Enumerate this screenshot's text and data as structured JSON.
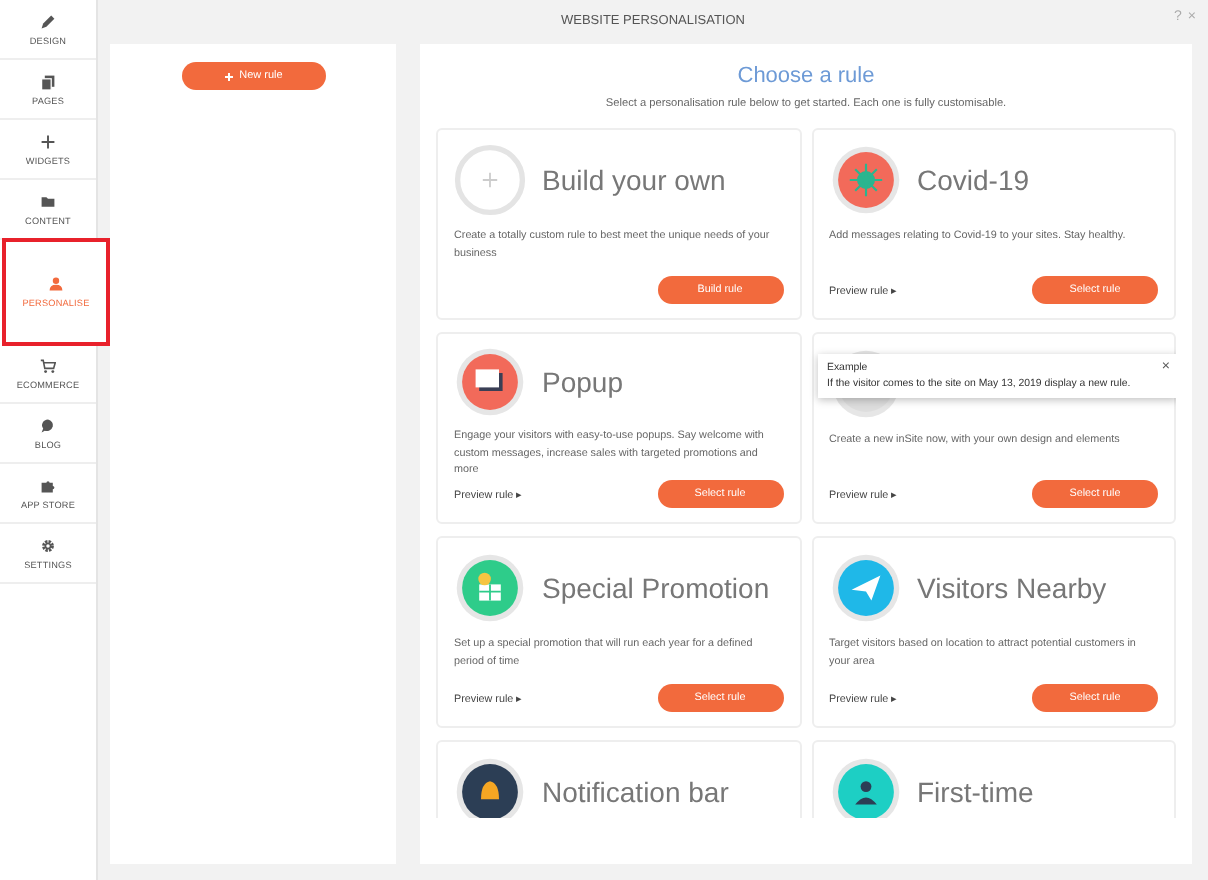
{
  "sidebar": {
    "items": [
      {
        "label": "DESIGN",
        "selected": false
      },
      {
        "label": "PAGES",
        "selected": false
      },
      {
        "label": "WIDGETS",
        "selected": false
      },
      {
        "label": "CONTENT",
        "selected": false
      },
      {
        "label": "PERSONALISE",
        "selected": true
      },
      {
        "label": "ECOMMERCE",
        "selected": false
      },
      {
        "label": "BLOG",
        "selected": false
      },
      {
        "label": "APP STORE",
        "selected": false
      },
      {
        "label": "SETTINGS",
        "selected": false
      }
    ]
  },
  "window": {
    "title": "WEBSITE PERSONALISATION",
    "help": "?",
    "close": "×"
  },
  "rules_panel": {
    "new_rule_button": "New rule"
  },
  "chooser": {
    "heading": "Choose a rule",
    "subtitle": "Select a personalisation rule below to get started. Each one is fully customisable.",
    "cards": [
      {
        "kind": "custom",
        "title": "Build your own",
        "description": "Create a totally custom rule to best meet the unique needs of your business",
        "button": "Build rule"
      },
      {
        "kind": "template",
        "color": "#f26a5a",
        "title": "Covid-19",
        "description": "Add messages relating to Covid-19 to your sites. Stay healthy.",
        "preview": "Preview rule ▸",
        "button": "Select rule"
      },
      {
        "kind": "template",
        "color": "#f26a5a",
        "title": "Popup",
        "description": "Engage your visitors with easy-to-use popups. Say welcome with custom messages, increase sales with targeted promotions and more",
        "preview": "Preview rule ▸",
        "button": "Select rule"
      },
      {
        "kind": "template",
        "color": "#dddddd",
        "description": "Create a new inSite now, with your own design and elements",
        "preview": "Preview rule ▸",
        "button": "Select rule",
        "tooltip": {
          "title": "Example",
          "text": "If the visitor comes to the site on May 13, 2019 display a new rule.",
          "close": "×"
        }
      },
      {
        "kind": "template",
        "color": "#2ecc8a",
        "title": "Special Promotion",
        "description": "Set up a special promotion that will run each year for a defined period of time",
        "preview": "Preview rule ▸",
        "button": "Select rule"
      },
      {
        "kind": "template",
        "color": "#1fb8e8",
        "title": "Visitors Nearby",
        "description": "Target visitors based on location to attract potential customers in your area",
        "preview": "Preview rule ▸",
        "button": "Select rule"
      },
      {
        "kind": "template",
        "color": "#2c3e55",
        "title": "Notification bar"
      },
      {
        "kind": "template",
        "color": "#1dcfc4",
        "title": "First-time"
      }
    ]
  }
}
